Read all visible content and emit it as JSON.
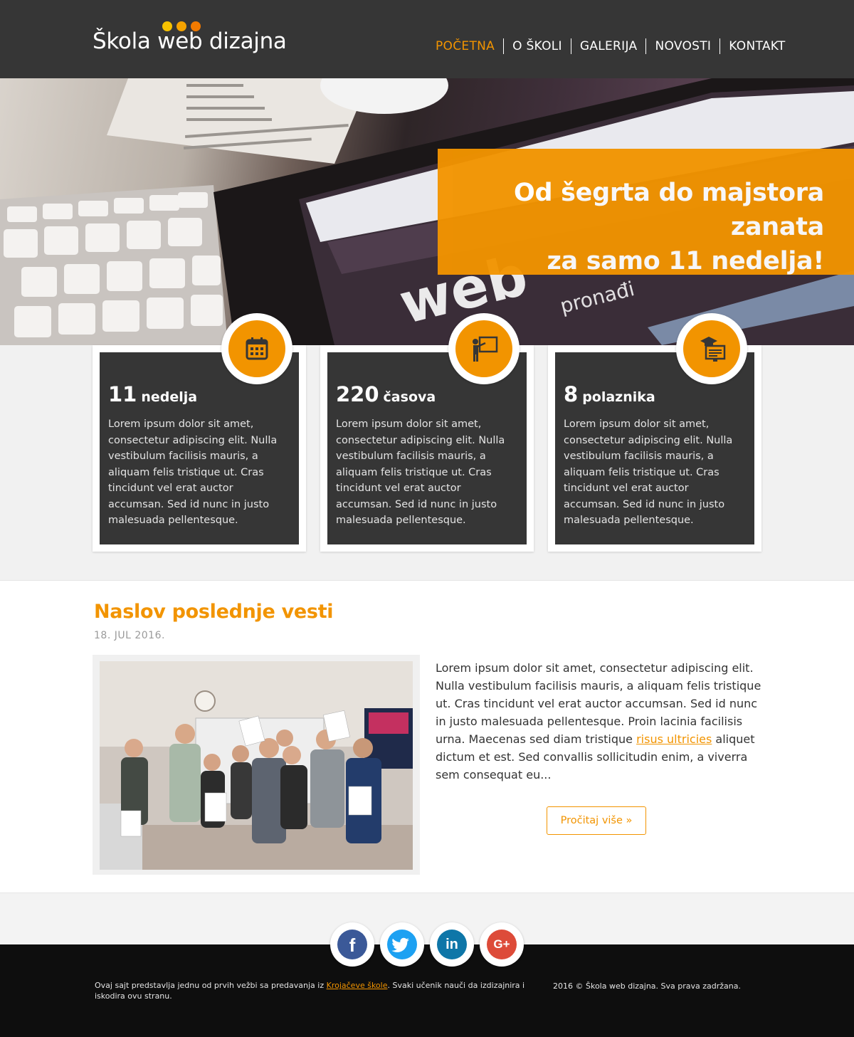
{
  "header": {
    "logo_text": "Škola web dizajna",
    "logo_dot_colors": [
      "#f7c200",
      "#f5a300",
      "#f27a00"
    ],
    "nav": [
      {
        "label": "POČETNA",
        "active": true
      },
      {
        "label": "O ŠKOLI",
        "active": false
      },
      {
        "label": "GALERIJA",
        "active": false
      },
      {
        "label": "NOVOSTI",
        "active": false
      },
      {
        "label": "KONTAKT",
        "active": false
      }
    ]
  },
  "hero": {
    "line1": "Od šegrta do majstora zanata",
    "line2": "za samo 11 nedelja!",
    "image": "keyboard-and-tablet-photo"
  },
  "features": [
    {
      "number": "11",
      "unit": "nedelja",
      "icon": "calendar-icon",
      "text": "Lorem ipsum dolor sit amet, consectetur adipiscing elit. Nulla vestibulum facilisis mauris, a aliquam felis tristique ut. Cras tincidunt vel erat auctor accumsan. Sed id nunc in justo malesuada pellentesque."
    },
    {
      "number": "220",
      "unit": "časova",
      "icon": "teacher-board-icon",
      "text": "Lorem ipsum dolor sit amet, consectetur adipiscing elit. Nulla vestibulum facilisis mauris, a aliquam felis tristique ut. Cras tincidunt vel erat auctor accumsan. Sed id nunc in justo malesuada pellentesque."
    },
    {
      "number": "8",
      "unit": "polaznika",
      "icon": "graduate-monitor-icon",
      "text": "Lorem ipsum dolor sit amet, consectetur adipiscing elit. Nulla vestibulum facilisis mauris, a aliquam felis tristique ut. Cras tincidunt vel erat auctor accumsan. Sed id nunc in justo malesuada pellentesque."
    }
  ],
  "news": {
    "title": "Naslov poslednje vesti",
    "date": "18. JUL 2016.",
    "photo": "group-photo-with-certificates",
    "body_before_link": "Lorem ipsum dolor sit amet, consectetur adipiscing elit. Nulla vestibulum facilisis mauris, a aliquam felis tristique ut. Cras tincidunt vel erat auctor accumsan. Sed id nunc in justo malesuada pellentesque. Proin lacinia facilisis urna. Maecenas sed diam tristique ",
    "link_text": "risus ultricies",
    "body_after_link": " aliquet dictum et est. Sed convallis sollicitudin enim, a viverra sem consequat eu...",
    "button_label": "Pročitaj više »"
  },
  "social": [
    {
      "name": "facebook",
      "glyph": "f",
      "color": "#3b5998"
    },
    {
      "name": "twitter",
      "glyph": "t",
      "color": "#1da1f2"
    },
    {
      "name": "linkedin",
      "glyph": "in",
      "color": "#0e76a8"
    },
    {
      "name": "google-plus",
      "glyph": "G+",
      "color": "#dd4b39"
    }
  ],
  "footer": {
    "left_before_link": "Ovaj sajt predstavlja jednu od prvih vežbi sa predavanja iz ",
    "left_link": "Krojačeve škole",
    "left_after_link": ". Svaki učenik nauči da izdizajnira i iskodira ovu stranu.",
    "right_text": "2016 © Škola web dizajna. Sva prava zadržana."
  },
  "colors": {
    "accent": "#f29400",
    "header_bg": "#363636",
    "footer_bg": "#0e0e0e"
  }
}
